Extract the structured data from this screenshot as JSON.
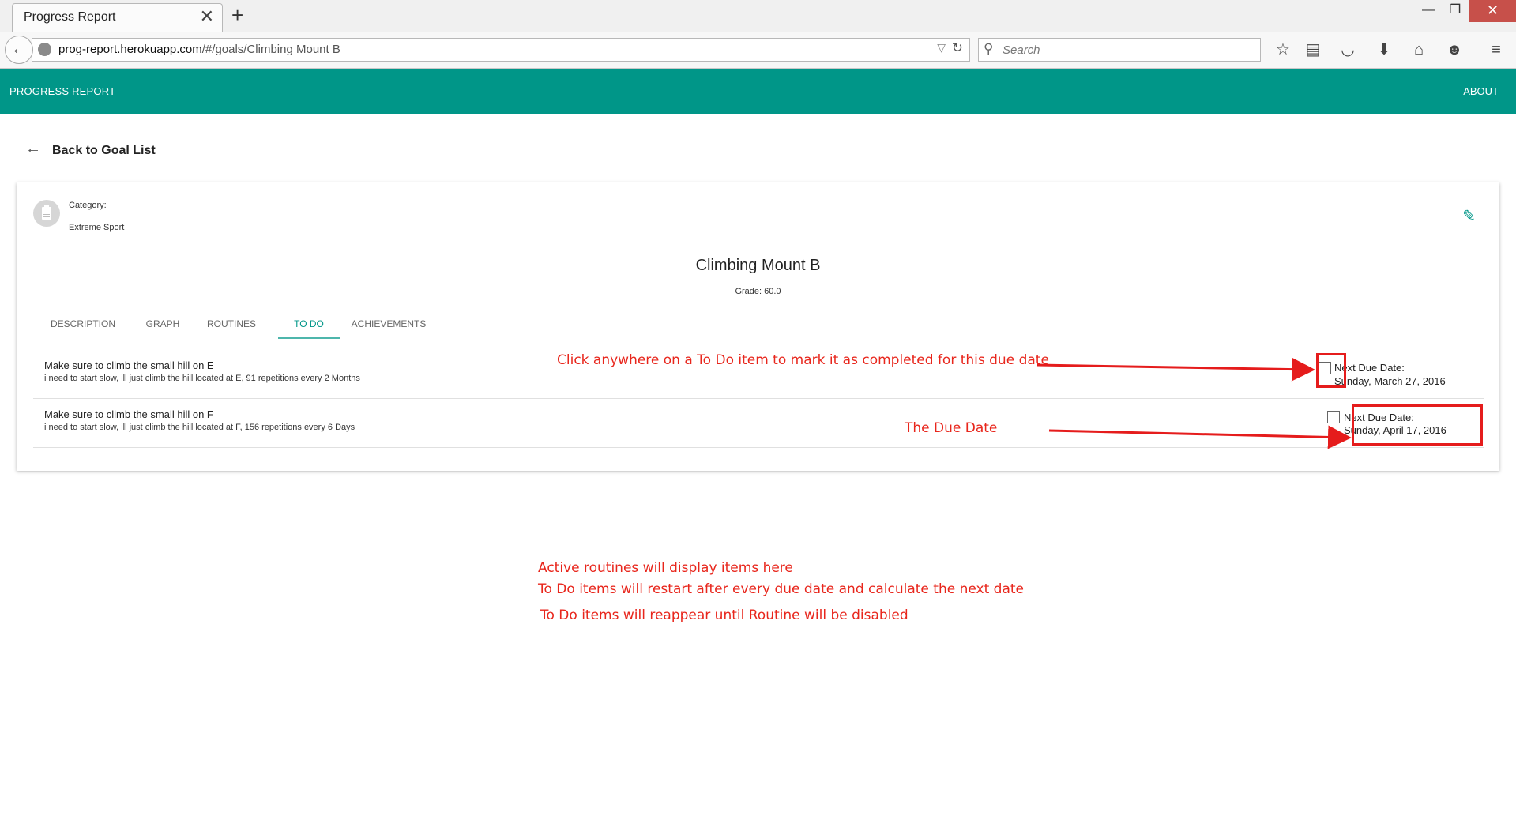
{
  "browser": {
    "tab_title": "Progress Report",
    "tab_close": "✕",
    "new_tab": "+",
    "url_host": "prog-report.herokuapp.com",
    "url_path": "/#/goals/Climbing Mount B",
    "search_placeholder": "Search",
    "window_controls": {
      "minimize": "—",
      "maximize": "❐",
      "close": "✕"
    },
    "toolbar_icons": [
      "bookmark-star-icon",
      "reading-list-icon",
      "pocket-icon",
      "download-icon",
      "home-icon",
      "hello-icon",
      "menu-icon"
    ]
  },
  "app": {
    "title": "PROGRESS REPORT",
    "about": "ABOUT",
    "accent_color": "#009688",
    "back_link": "Back to Goal List",
    "category_label": "Category:",
    "category_value": "Extreme Sport",
    "goal_title": "Climbing Mount B",
    "grade": "Grade: 60.0",
    "tabs": [
      {
        "label": "DESCRIPTION",
        "active": false
      },
      {
        "label": "GRAPH",
        "active": false
      },
      {
        "label": "ROUTINES",
        "active": false
      },
      {
        "label": "TO DO",
        "active": true
      },
      {
        "label": "ACHIEVEMENTS",
        "active": false
      }
    ],
    "todos": [
      {
        "title": "Make sure to climb the small hill on E",
        "description": "i need to start slow, ill just climb the hill located at E, 91 repetitions every 2 Months",
        "due_label": "Next Due Date:",
        "due_date": "Sunday, March 27, 2016",
        "checked": false
      },
      {
        "title": "Make sure to climb the small hill on F",
        "description": "i need to start slow, ill just climb the hill located at F, 156 repetitions every 6 Days",
        "due_label": "Next Due Date:",
        "due_date": "Sunday, April 17, 2016",
        "checked": false
      }
    ]
  },
  "annotations": {
    "color": "#e8261c",
    "click_hint": "Click anywhere on a To Do item to mark it as completed for this due date",
    "due_date_hint": "The Due Date",
    "notes": [
      "Active routines will display items here",
      "To Do items will restart after every due date and calculate the next date",
      "To Do items will reappear until Routine will be disabled"
    ]
  }
}
